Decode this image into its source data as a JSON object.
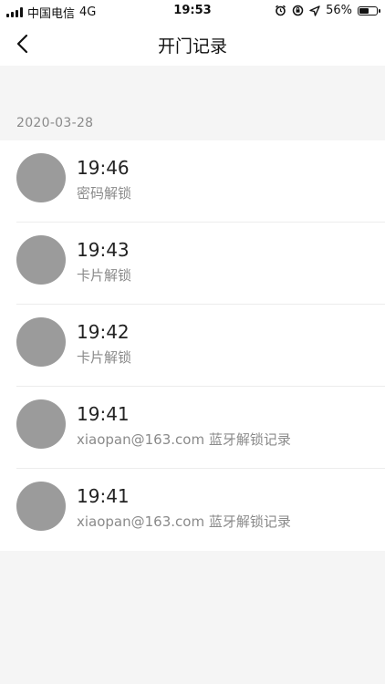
{
  "status_bar": {
    "carrier": "中国电信",
    "network": "4G",
    "time": "19:53",
    "battery_percent": "56%",
    "battery_level": 0.56
  },
  "nav": {
    "title": "开门记录",
    "back_icon": "chevron-left-icon"
  },
  "date_group": "2020-03-28",
  "records": [
    {
      "time": "19:46",
      "desc": " 密码解锁"
    },
    {
      "time": "19:43",
      "desc": " 卡片解锁"
    },
    {
      "time": "19:42",
      "desc": " 卡片解锁"
    },
    {
      "time": "19:41",
      "desc": "xiaopan@163.com 蓝牙解锁记录"
    },
    {
      "time": "19:41",
      "desc": "xiaopan@163.com 蓝牙解锁记录"
    }
  ],
  "colors": {
    "avatar": "#9b9b9b",
    "background": "#f5f5f5",
    "secondary_text": "#8a8a8a"
  }
}
